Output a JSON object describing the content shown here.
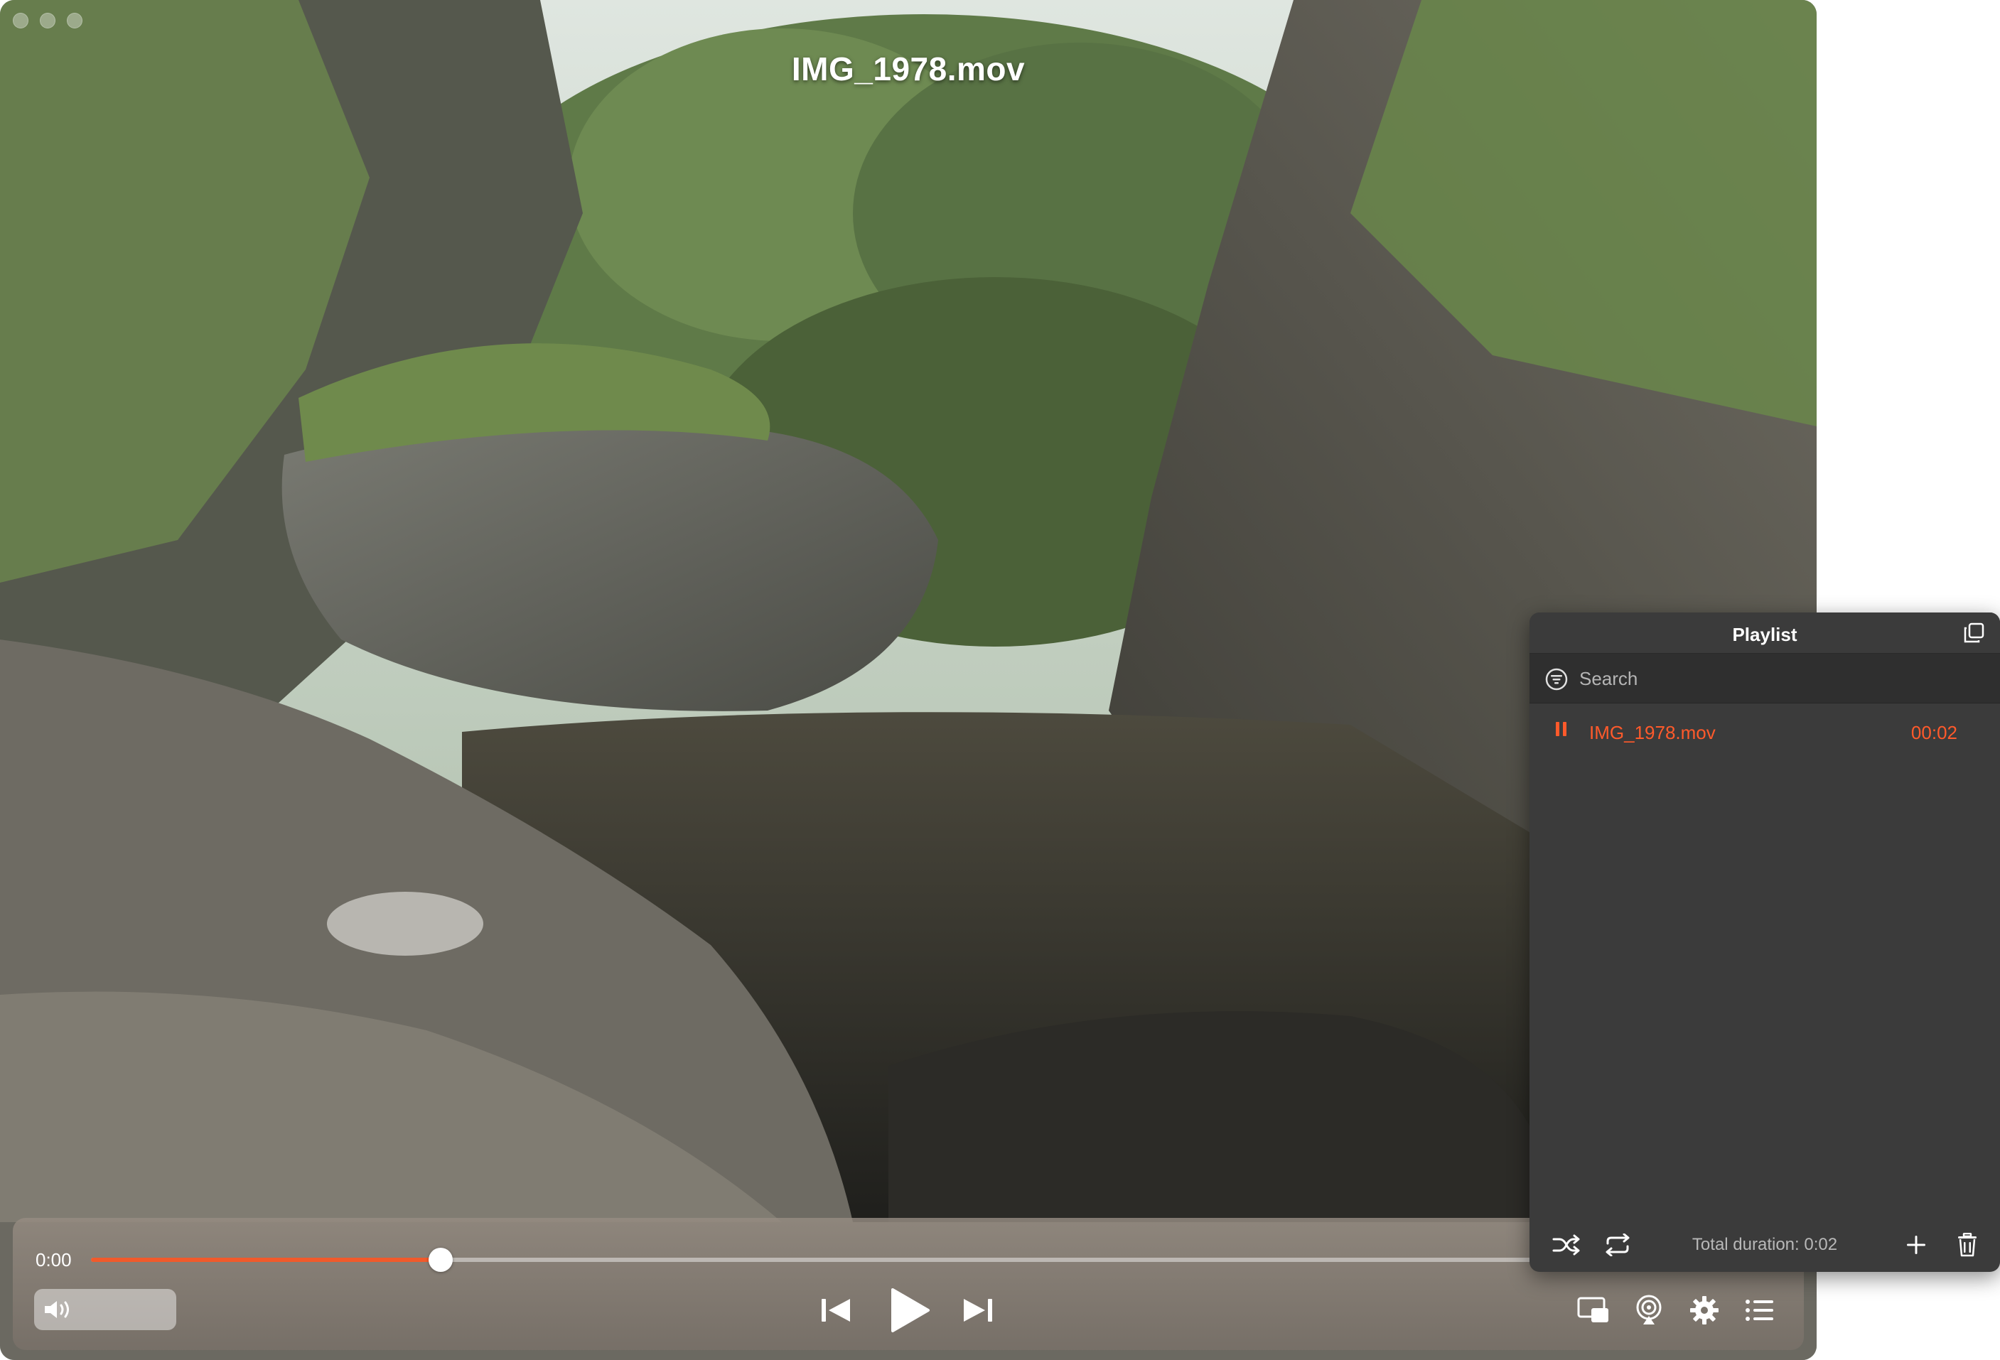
{
  "window": {
    "video_title": "IMG_1978.mov"
  },
  "controls": {
    "current_time": "0:00",
    "progress_fraction": 0.205,
    "icons": {
      "volume": "speaker-icon",
      "previous": "skip-previous-icon",
      "play": "play-icon",
      "next": "skip-next-icon",
      "pip": "picture-in-picture-icon",
      "airplay": "airplay-icon",
      "settings": "gear-icon",
      "playlist": "list-icon"
    }
  },
  "playlist": {
    "title": "Playlist",
    "search_placeholder": "Search",
    "items": [
      {
        "name": "IMG_1978.mov",
        "duration": "00:02",
        "state": "playing"
      }
    ],
    "total_duration": "Total duration: 0:02",
    "accent_color": "#ff5a2b"
  },
  "colors": {
    "accent": "#f15a2b",
    "panel_bg": "#3b3b3b"
  }
}
